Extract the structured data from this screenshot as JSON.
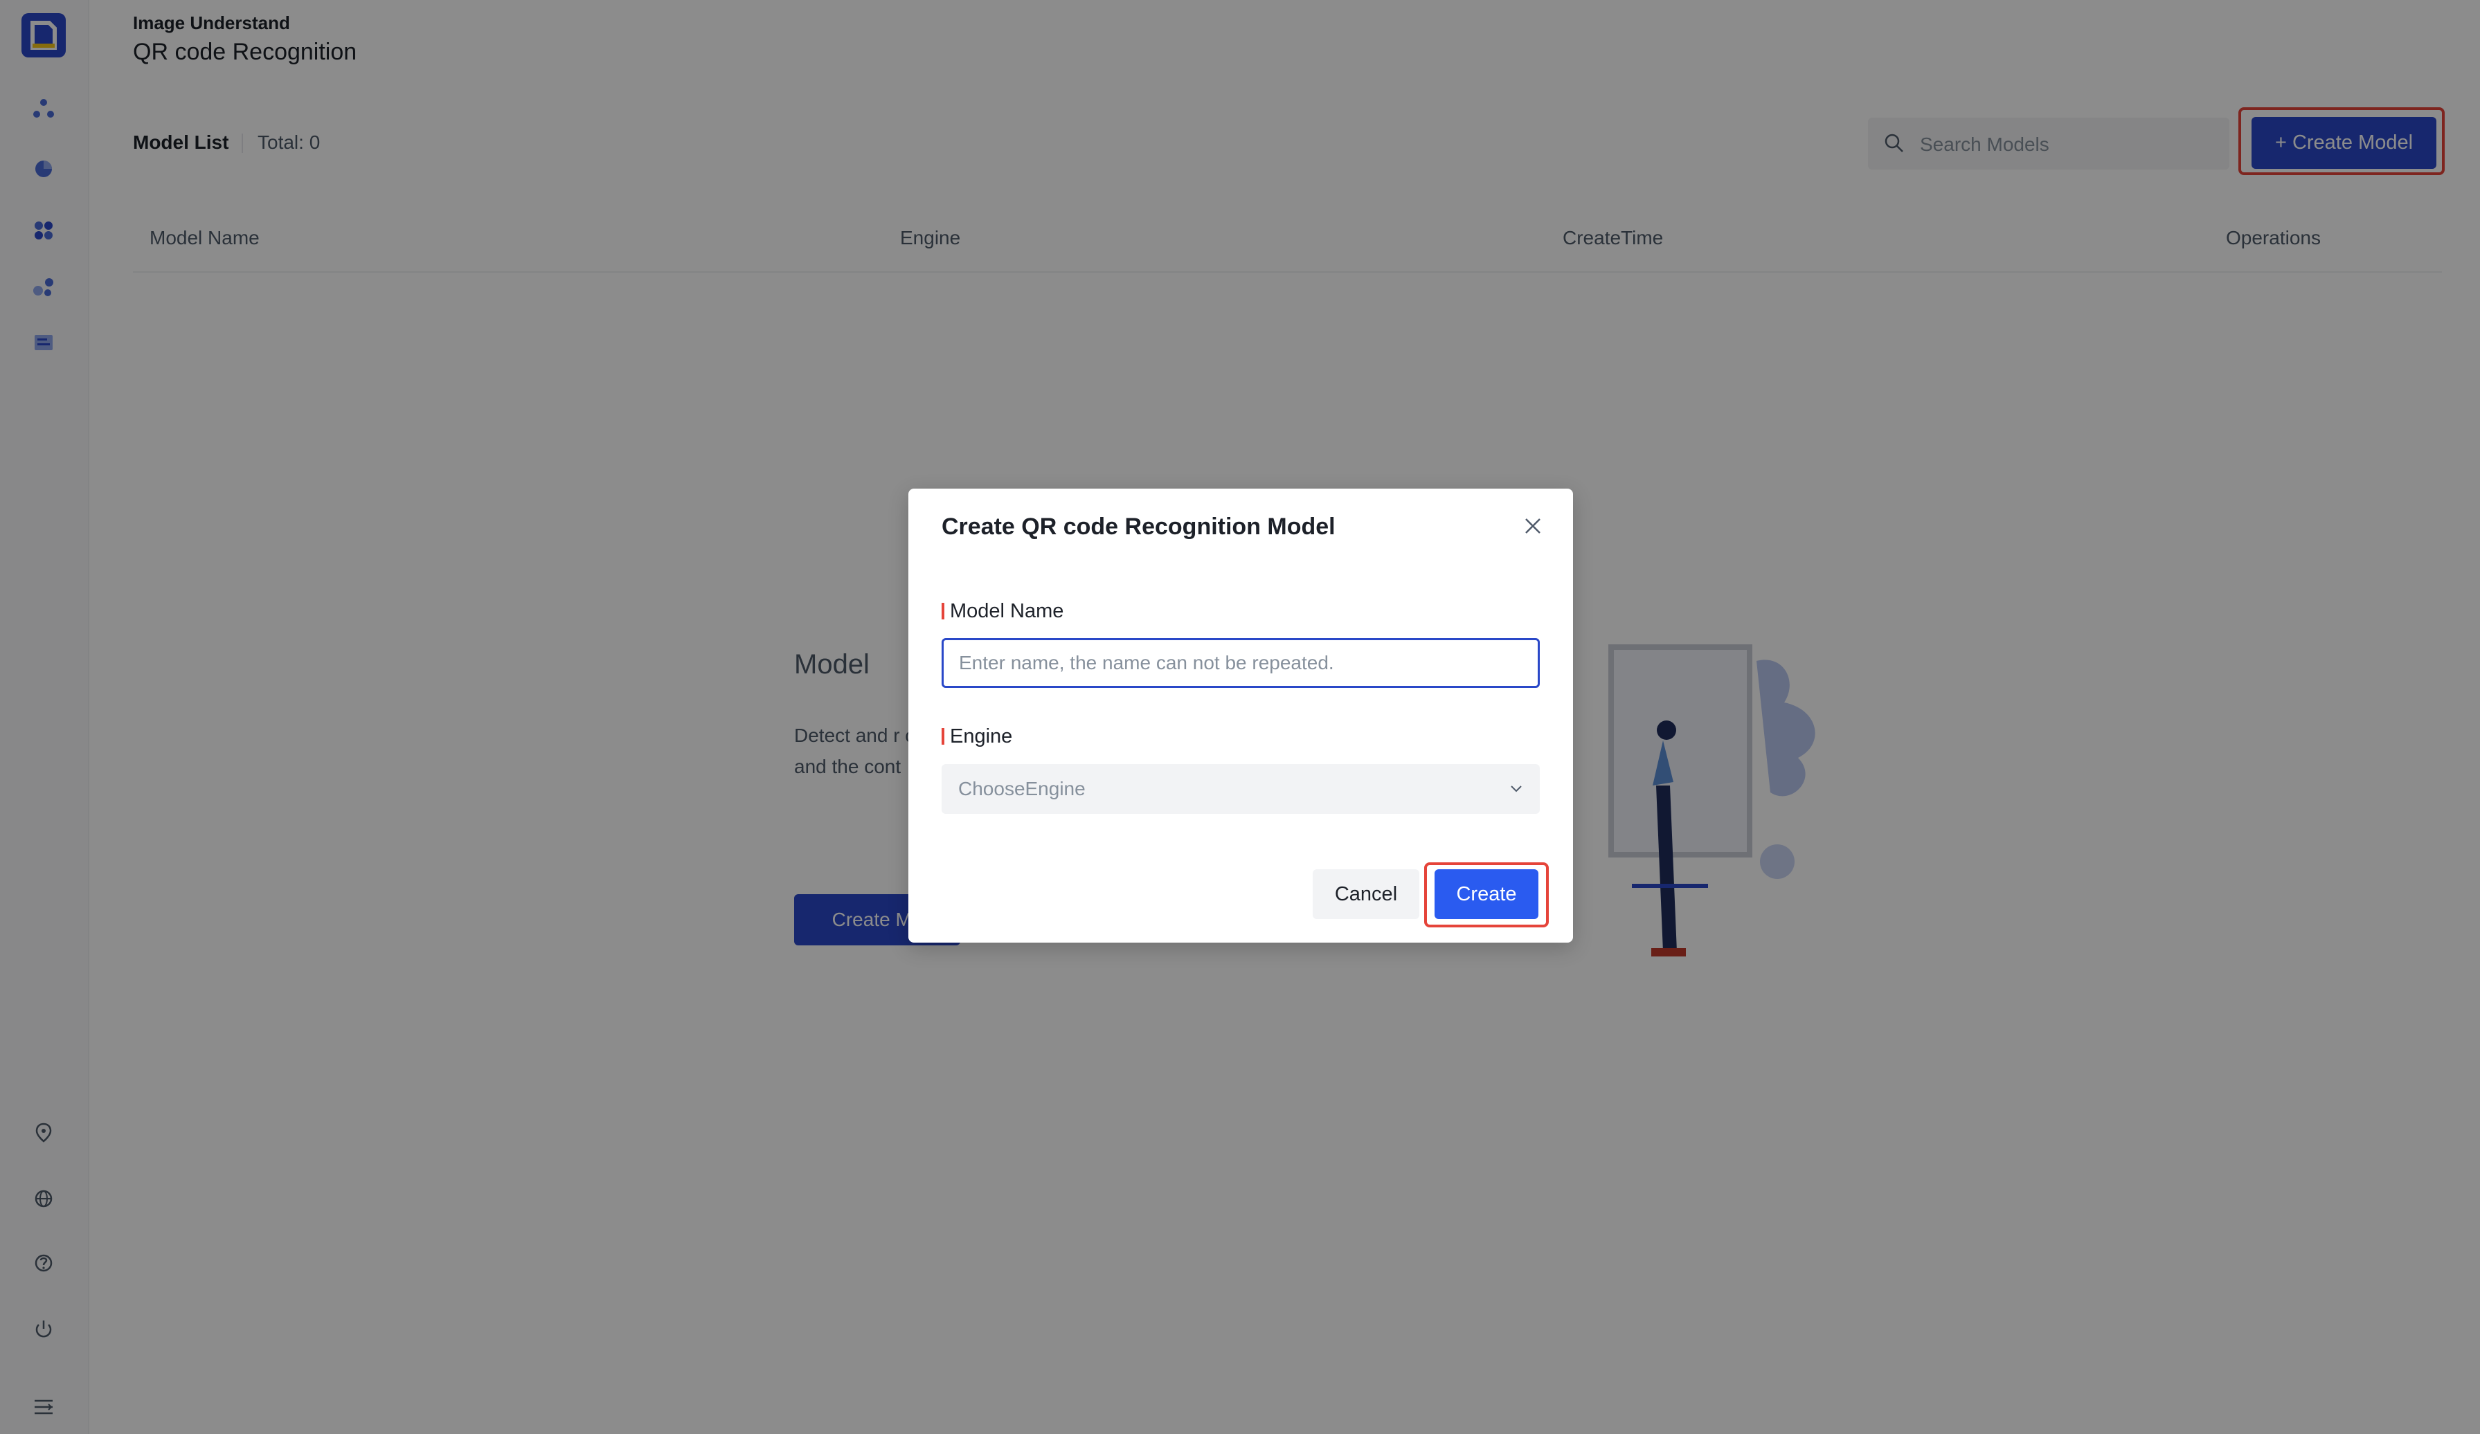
{
  "header": {
    "breadcrumb": "Image Understand",
    "title": "QR code Recognition"
  },
  "list": {
    "title": "Model List",
    "total": "Total: 0"
  },
  "search": {
    "placeholder": "Search Models"
  },
  "toolbar": {
    "create_model_label": "+ Create Model"
  },
  "table": {
    "columns": [
      "Model Name",
      "Engine",
      "CreateTime",
      "Operations"
    ]
  },
  "empty_state": {
    "title": "Model",
    "description": "Detect and r code in the i includes the and the cont",
    "button_label": "Create Mo"
  },
  "modal": {
    "title": "Create QR code Recognition Model",
    "name_label": "Model Name",
    "name_placeholder": "Enter name, the name can not be repeated.",
    "engine_label": "Engine",
    "engine_placeholder": "ChooseEngine",
    "cancel_label": "Cancel",
    "create_label": "Create"
  },
  "sidebar": {
    "icons": [
      "app-logo-icon",
      "nodes-icon",
      "pie-chart-icon",
      "grid-apps-icon",
      "dots-icon",
      "list-icon",
      "location-icon",
      "globe-icon",
      "help-icon",
      "power-icon",
      "collapse-menu-icon"
    ]
  },
  "colors": {
    "primary": "#2a48c8",
    "create_button": "#2a5bf0",
    "highlight": "#e5443a"
  }
}
